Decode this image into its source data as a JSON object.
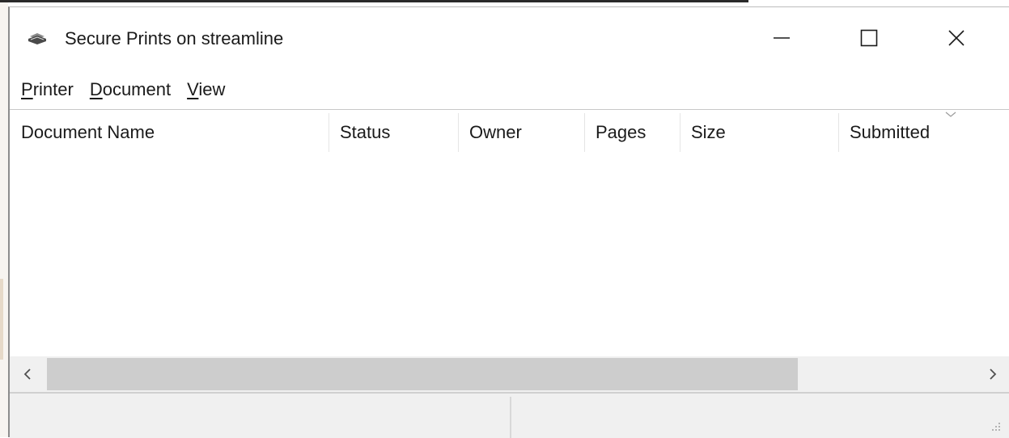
{
  "window": {
    "title": "Secure Prints on streamline",
    "icon": "printer-icon",
    "controls": {
      "minimize": "minimize-icon",
      "maximize": "maximize-icon",
      "close": "close-icon"
    }
  },
  "menu": {
    "items": [
      {
        "access_key": "P",
        "rest": "rinter"
      },
      {
        "access_key": "D",
        "rest": "ocument"
      },
      {
        "access_key": "V",
        "rest": "iew"
      }
    ]
  },
  "list": {
    "columns": [
      "Document Name",
      "Status",
      "Owner",
      "Pages",
      "Size",
      "Submitted"
    ],
    "sorted_column": "Submitted",
    "sort_indicator": "chevron-down-icon",
    "rows": []
  },
  "scrollbar": {
    "left_arrow": "chevron-left-icon",
    "right_arrow": "chevron-right-icon"
  },
  "status_bar": {
    "left_text": "",
    "right_text": "",
    "grip": "resize-grip-icon"
  },
  "colors": {
    "window_bg": "#ffffff",
    "chrome_bg": "#f0f0f0",
    "scroll_thumb": "#cdcdcd",
    "text": "#1a1a1a"
  }
}
